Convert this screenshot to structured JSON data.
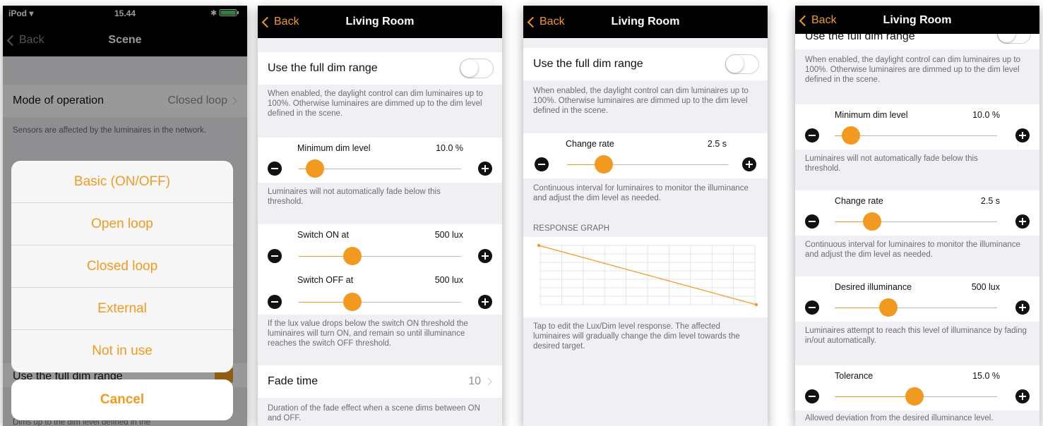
{
  "colors": {
    "accent": "#f29a1f",
    "navbar": "#000000",
    "background": "#efeff4"
  },
  "screen1": {
    "status": {
      "carrier": "iPod",
      "time": "15.44"
    },
    "nav": {
      "back": "Back",
      "title": "Scene"
    },
    "mode_label": "Mode of operation",
    "mode_value": "Closed loop",
    "mode_note": "Sensors are affected by the luminaires in the network.",
    "behind_row_label": "Use the full dim range",
    "behind_note": "Dims up to the dim level defined in the",
    "options": [
      "Basic (ON/OFF)",
      "Open loop",
      "Closed loop",
      "External",
      "Not in use"
    ],
    "cancel": "Cancel"
  },
  "screen2": {
    "nav": {
      "back": "Back",
      "title": "Living Room"
    },
    "full_dim_label": "Use the full dim range",
    "full_dim_note": "When enabled, the daylight control can dim luminaires up to 100%. Otherwise luminaires are dimmed up to the dim level defined in the scene.",
    "min_dim": {
      "label": "Minimum dim level",
      "value": "10.0 %",
      "position": 0.1
    },
    "min_dim_note": "Luminaires will not automatically fade below this threshold.",
    "switch_on": {
      "label": "Switch ON at",
      "value": "500 lux",
      "position": 0.33
    },
    "switch_off": {
      "label": "Switch OFF at",
      "value": "500 lux",
      "position": 0.33
    },
    "switch_note": "If the lux value drops below the switch ON threshold the luminaires will turn ON, and remain so until illuminance reaches the switch OFF threshold.",
    "fade_label": "Fade time",
    "fade_value": "10",
    "fade_note": "Duration of the fade effect when a scene dims between ON and OFF."
  },
  "screen3": {
    "nav": {
      "back": "Back",
      "title": "Living Room"
    },
    "full_dim_label": "Use the full dim range",
    "full_dim_note": "When enabled, the daylight control can dim luminaires up to 100%. Otherwise luminaires are dimmed up to the dim level defined in the scene.",
    "change_rate": {
      "label": "Change rate",
      "value": "2.5 s",
      "position": 0.23
    },
    "change_rate_note": "Continuous interval for luminaires to monitor the illuminance and adjust the dim level as needed.",
    "graph_header": "RESPONSE GRAPH",
    "graph_note": "Tap to edit the Lux/Dim level response. The affected luminaires will gradually change the dim level towards the desired target.",
    "graph_line": {
      "start": 1.0,
      "end": 0.0
    }
  },
  "screen4": {
    "nav": {
      "back": "Back",
      "title": "Living Room"
    },
    "full_dim_label": "Use the full dim range",
    "full_dim_note": "When enabled, the daylight control can dim luminaires up to 100%. Otherwise luminaires are dimmed up to the dim level defined in the scene.",
    "min_dim": {
      "label": "Minimum dim level",
      "value": "10.0 %",
      "position": 0.1
    },
    "min_dim_note": "Luminaires will not automatically fade below this threshold.",
    "change_rate": {
      "label": "Change rate",
      "value": "2.5 s",
      "position": 0.23
    },
    "change_rate_note": "Continuous interval for luminaires to monitor the illuminance and adjust the dim level as needed.",
    "desired": {
      "label": "Desired illuminance",
      "value": "500 lux",
      "position": 0.33
    },
    "desired_note": "Luminaires attempt to reach this level of illuminance by fading in/out automatically.",
    "tolerance": {
      "label": "Tolerance",
      "value": "15.0 %",
      "position": 0.49
    },
    "tolerance_note": "Allowed deviation from the desired illuminance level."
  }
}
